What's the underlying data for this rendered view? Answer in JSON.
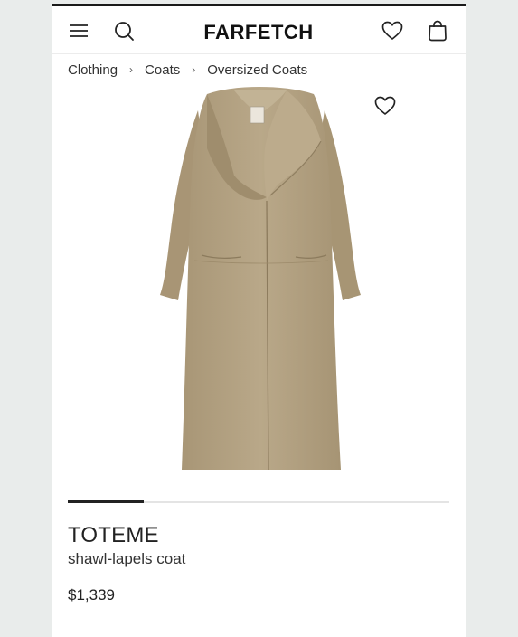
{
  "header": {
    "logo": "FARFETCH",
    "icons": [
      "menu-icon",
      "search-icon",
      "wishlist-icon",
      "bag-icon"
    ]
  },
  "breadcrumb": {
    "items": [
      "Clothing",
      "Coats",
      "Oversized Coats"
    ],
    "separator": "›"
  },
  "product": {
    "brand": "TOTEME",
    "name": "shawl-lapels coat",
    "price": "$1,339",
    "image_icon": "coat-image",
    "favorite_icon": "heart-icon",
    "coat_color": "#b3a283"
  },
  "carousel": {
    "progress": 0.2
  },
  "colors": {
    "page_background": "#e9eceb",
    "header_rule": "#1a1a1a",
    "text": "#222222"
  }
}
